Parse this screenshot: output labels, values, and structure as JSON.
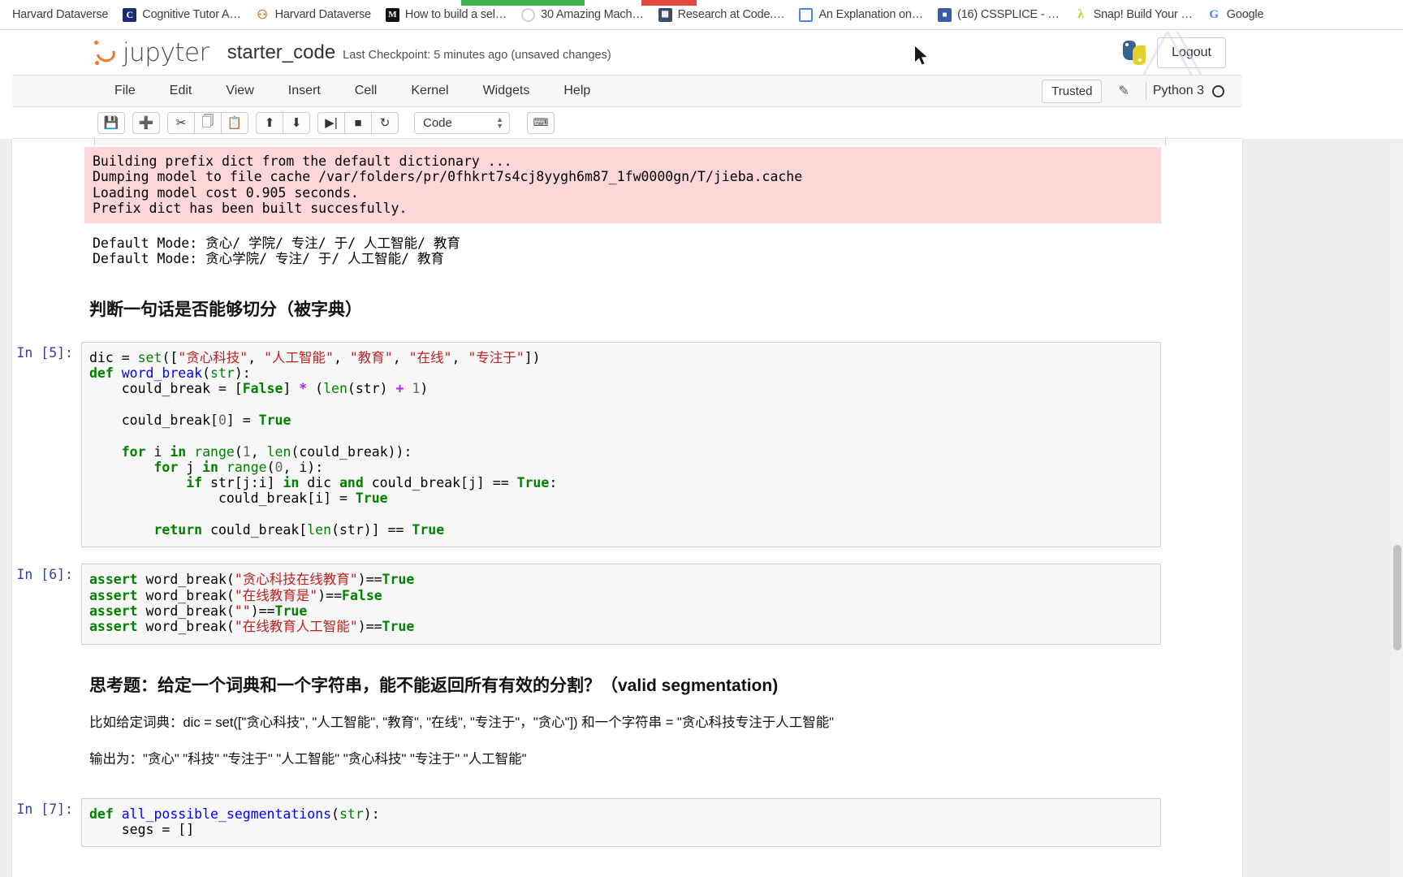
{
  "browser": {
    "bookmarks": [
      {
        "label": "Harvard Dataverse",
        "icon": "none-icon"
      },
      {
        "label": "Cognitive Tutor A…",
        "icon": "blue-c-icon"
      },
      {
        "label": "Harvard Dataverse",
        "icon": "dataverse-icon"
      },
      {
        "label": "How to build a sel…",
        "icon": "medium-m-icon"
      },
      {
        "label": "30 Amazing Mach…",
        "icon": "circle-icon"
      },
      {
        "label": "Research at Code.…",
        "icon": "grid-icon"
      },
      {
        "label": "An Explanation on…",
        "icon": "document-icon"
      },
      {
        "label": "(16) CSSPLICE - …",
        "icon": "chat-icon"
      },
      {
        "label": "Snap! Build Your …",
        "icon": "snap-lambda-icon"
      },
      {
        "label": "Google",
        "icon": "google-g-icon"
      }
    ]
  },
  "jupyter": {
    "wordmark": "jupyter",
    "notebook_name": "starter_code",
    "checkpoint": "Last Checkpoint: 5 minutes ago (unsaved changes)",
    "logout_label": "Logout",
    "menus": [
      "File",
      "Edit",
      "View",
      "Insert",
      "Cell",
      "Kernel",
      "Widgets",
      "Help"
    ],
    "trusted_label": "Trusted",
    "kernel_name": "Python 3",
    "toolbar": {
      "groups": [
        [
          "save-icon"
        ],
        [
          "insert-cell-below-icon"
        ],
        [
          "cut-icon",
          "copy-icon",
          "paste-icon"
        ],
        [
          "move-up-icon",
          "move-down-icon"
        ],
        [
          "run-icon",
          "interrupt-icon",
          "restart-icon"
        ]
      ],
      "cell_type": "Code",
      "command_palette": "keyboard-icon"
    }
  },
  "notebook": {
    "cells": [
      {
        "kind": "output-stderr",
        "prompt": "",
        "text": "Building prefix dict from the default dictionary ...\nDumping model to file cache /var/folders/pr/0fhkrt7s4cj8yygh6m87_1fw0000gn/T/jieba.cache\nLoading model cost 0.905 seconds.\nPrefix dict has been built succesfully."
      },
      {
        "kind": "output-stdout",
        "prompt": "",
        "text": "Default Mode: 贪心/ 学院/ 专注/ 于/ 人工智能/ 教育\nDefault Mode: 贪心学院/ 专注/ 于/ 人工智能/ 教育"
      },
      {
        "kind": "markdown-heading",
        "prompt": "",
        "text": "判断一句话是否能够切分（被字典）"
      },
      {
        "kind": "code",
        "prompt": "In [5]:",
        "lines": [
          [
            {
              "t": "dic ",
              "c": ""
            },
            {
              "t": "= ",
              "c": ""
            },
            {
              "t": "set",
              "c": "nb"
            },
            {
              "t": "([",
              "c": ""
            },
            {
              "t": "\"贪心科技\"",
              "c": "s"
            },
            {
              "t": ", ",
              "c": ""
            },
            {
              "t": "\"人工智能\"",
              "c": "s"
            },
            {
              "t": ", ",
              "c": ""
            },
            {
              "t": "\"教育\"",
              "c": "s"
            },
            {
              "t": ", ",
              "c": ""
            },
            {
              "t": "\"在线\"",
              "c": "s"
            },
            {
              "t": ", ",
              "c": ""
            },
            {
              "t": "\"专注于\"",
              "c": "s"
            },
            {
              "t": "])",
              "c": ""
            }
          ],
          [
            {
              "t": "def ",
              "c": "k"
            },
            {
              "t": "word_break",
              "c": "fn"
            },
            {
              "t": "(",
              "c": ""
            },
            {
              "t": "str",
              "c": "nb"
            },
            {
              "t": "):",
              "c": ""
            }
          ],
          [
            {
              "t": "    could_break = [",
              "c": ""
            },
            {
              "t": "False",
              "c": "bi"
            },
            {
              "t": "] ",
              "c": ""
            },
            {
              "t": "* ",
              "c": "o"
            },
            {
              "t": "(",
              "c": ""
            },
            {
              "t": "len",
              "c": "nb"
            },
            {
              "t": "(str) ",
              "c": ""
            },
            {
              "t": "+ ",
              "c": "o"
            },
            {
              "t": "1",
              "c": "n"
            },
            {
              "t": ")",
              "c": ""
            }
          ],
          [
            {
              "t": "",
              "c": ""
            }
          ],
          [
            {
              "t": "    could_break[",
              "c": ""
            },
            {
              "t": "0",
              "c": "n"
            },
            {
              "t": "] = ",
              "c": ""
            },
            {
              "t": "True",
              "c": "bi"
            }
          ],
          [
            {
              "t": "",
              "c": ""
            }
          ],
          [
            {
              "t": "    ",
              "c": ""
            },
            {
              "t": "for ",
              "c": "k"
            },
            {
              "t": "i ",
              "c": ""
            },
            {
              "t": "in ",
              "c": "k"
            },
            {
              "t": "range",
              "c": "nb"
            },
            {
              "t": "(",
              "c": ""
            },
            {
              "t": "1",
              "c": "n"
            },
            {
              "t": ", ",
              "c": ""
            },
            {
              "t": "len",
              "c": "nb"
            },
            {
              "t": "(could_break)):",
              "c": ""
            }
          ],
          [
            {
              "t": "        ",
              "c": ""
            },
            {
              "t": "for ",
              "c": "k"
            },
            {
              "t": "j ",
              "c": ""
            },
            {
              "t": "in ",
              "c": "k"
            },
            {
              "t": "range",
              "c": "nb"
            },
            {
              "t": "(",
              "c": ""
            },
            {
              "t": "0",
              "c": "n"
            },
            {
              "t": ", i):",
              "c": ""
            }
          ],
          [
            {
              "t": "            ",
              "c": ""
            },
            {
              "t": "if ",
              "c": "k"
            },
            {
              "t": "str[j:i] ",
              "c": ""
            },
            {
              "t": "in ",
              "c": "k"
            },
            {
              "t": "dic ",
              "c": ""
            },
            {
              "t": "and ",
              "c": "k"
            },
            {
              "t": "could_break[j] == ",
              "c": ""
            },
            {
              "t": "True",
              "c": "bi"
            },
            {
              "t": ":",
              "c": ""
            }
          ],
          [
            {
              "t": "                could_break[i] = ",
              "c": ""
            },
            {
              "t": "True",
              "c": "bi"
            }
          ],
          [
            {
              "t": "",
              "c": ""
            }
          ],
          [
            {
              "t": "        ",
              "c": ""
            },
            {
              "t": "return ",
              "c": "k"
            },
            {
              "t": "could_break[",
              "c": ""
            },
            {
              "t": "len",
              "c": "nb"
            },
            {
              "t": "(str)] == ",
              "c": ""
            },
            {
              "t": "True",
              "c": "bi"
            }
          ]
        ]
      },
      {
        "kind": "code",
        "prompt": "In [6]:",
        "lines": [
          [
            {
              "t": "assert ",
              "c": "k"
            },
            {
              "t": "word_break(",
              "c": ""
            },
            {
              "t": "\"贪心科技在线教育\"",
              "c": "s"
            },
            {
              "t": ")==",
              "c": ""
            },
            {
              "t": "True",
              "c": "bi"
            }
          ],
          [
            {
              "t": "assert ",
              "c": "k"
            },
            {
              "t": "word_break(",
              "c": ""
            },
            {
              "t": "\"在线教育是\"",
              "c": "s"
            },
            {
              "t": ")==",
              "c": ""
            },
            {
              "t": "False",
              "c": "bi"
            }
          ],
          [
            {
              "t": "assert ",
              "c": "k"
            },
            {
              "t": "word_break(",
              "c": ""
            },
            {
              "t": "\"\"",
              "c": "s"
            },
            {
              "t": ")==",
              "c": ""
            },
            {
              "t": "True",
              "c": "bi"
            }
          ],
          [
            {
              "t": "assert ",
              "c": "k"
            },
            {
              "t": "word_break(",
              "c": ""
            },
            {
              "t": "\"在线教育人工智能\"",
              "c": "s"
            },
            {
              "t": ")==",
              "c": ""
            },
            {
              "t": "True",
              "c": "bi"
            }
          ]
        ]
      },
      {
        "kind": "markdown-heading",
        "prompt": "",
        "text": "思考题：给定一个词典和一个字符串，能不能返回所有有效的分割？（valid segmentation)"
      },
      {
        "kind": "markdown-para",
        "prompt": "",
        "text": "比如给定词典：dic = set([\"贪心科技\", \"人工智能\", \"教育\", \"在线\", \"专注于\"，\"贪心\"]) 和一个字符串 = \"贪心科技专注于人工智能\""
      },
      {
        "kind": "markdown-para",
        "prompt": "",
        "text": "输出为：\"贪心\" \"科技\" \"专注于\" \"人工智能\" \"贪心科技\" \"专注于\" \"人工智能\""
      },
      {
        "kind": "code",
        "prompt": "In [7]:",
        "lines": [
          [
            {
              "t": "def ",
              "c": "k"
            },
            {
              "t": "all_possible_segmentations",
              "c": "fn"
            },
            {
              "t": "(",
              "c": ""
            },
            {
              "t": "str",
              "c": "nb"
            },
            {
              "t": "):",
              "c": ""
            }
          ],
          [
            {
              "t": "    segs = []",
              "c": ""
            }
          ]
        ]
      }
    ]
  },
  "colors": {
    "jupyter_orange": "#f37726",
    "prompt_blue": "#303F9F",
    "stderr_pink": "#fdd7d7",
    "string_red": "#BA2121",
    "keyword_green": "#008000"
  }
}
